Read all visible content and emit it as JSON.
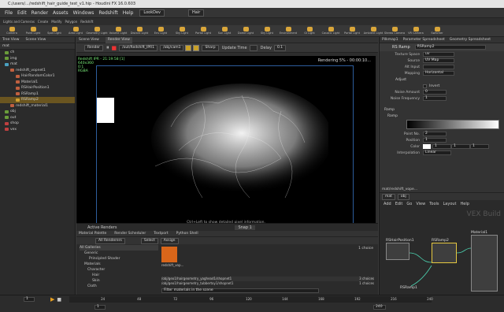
{
  "window": {
    "title": "C:/users/.../redshift_hair_guide_test_v1.hip - Houdini FX 16.0.603"
  },
  "menu": {
    "items": [
      "File",
      "Edit",
      "Render",
      "Assets",
      "Windows",
      "Redshift",
      "Help"
    ],
    "desktop": "LookDev",
    "scene": "Hair"
  },
  "shelf": {
    "tabs": [
      "Lights and Cameras",
      "Create",
      "Modify",
      "Polygon",
      "Redshift"
    ],
    "tools": [
      "Camera",
      "Point Light",
      "Spot Light",
      "Area Light",
      "Geometry Light",
      "Volume Light",
      "Distant Light",
      "Env Light",
      "Sky Light",
      "Portal Light",
      "Sun Light",
      "Dome Light",
      "Sky Light",
      "Environment",
      "GI Light",
      "Caustic Light",
      "Portal Light",
      "Ambient Light",
      "Stereo Camera",
      "VR Camera",
      "Switcher"
    ]
  },
  "tree": {
    "tabs": [
      "Tree View",
      "Scene View"
    ],
    "path": "mat",
    "items": [
      {
        "label": "ch",
        "level": 0,
        "color": "#6a9c3a"
      },
      {
        "label": "img",
        "level": 0,
        "color": "#6a9c3a"
      },
      {
        "label": "mat",
        "level": 0,
        "color": "#4aa0c0"
      },
      {
        "label": "redshift_vopnet1",
        "level": 1,
        "color": "#c06040"
      },
      {
        "label": "HairRandomColor1",
        "level": 2,
        "color": "#c06040"
      },
      {
        "label": "Material1",
        "level": 2,
        "color": "#c06040"
      },
      {
        "label": "RSHairPosition1",
        "level": 2,
        "color": "#c06040"
      },
      {
        "label": "RSRamp1",
        "level": 2,
        "color": "#c06040"
      },
      {
        "label": "RSRamp2",
        "level": 2,
        "color": "#d0a030",
        "selected": true
      },
      {
        "label": "redshift_material1",
        "level": 1,
        "color": "#c06040"
      },
      {
        "label": "obj",
        "level": 0,
        "color": "#6a9c3a"
      },
      {
        "label": "out",
        "level": 0,
        "color": "#6a9c3a"
      },
      {
        "label": "shop",
        "level": 0,
        "color": "#c04040"
      },
      {
        "label": "vex",
        "level": 0,
        "color": "#c04040"
      }
    ]
  },
  "center": {
    "tabs": [
      "Scene View",
      "Render View"
    ],
    "render_label": "Render",
    "rop": "/out/Redshift_IPR1",
    "camera": "/obj/cam1",
    "sharp": "Sharp",
    "update_time": "Update Time",
    "delay": "Delay",
    "delay_val": "0.1",
    "info": "Redshift IPR - 21:19:58 [1]",
    "info2": "640x360",
    "info3": "0:1",
    "info4": "RGBA",
    "progress": "Rendering 5% - 00:00:10...",
    "hint": "Ctrl+Left to show detailed pixel information.",
    "bottom_tabs": [
      "Active Renders",
      "Snap 1"
    ]
  },
  "matpal": {
    "tabs": [
      "Material Palette",
      "Render Scheduler",
      "Textport",
      "Python Shell"
    ],
    "renderers": "All Renderers",
    "select": "Select",
    "assign": "Assign",
    "galleries": [
      "All Galleries",
      "Generic",
      "Principled Shader",
      "Materials",
      "Character",
      "Hair",
      "Skin",
      "Cloth"
    ],
    "thumb_label": "redshift_vop...",
    "choice": "1 choice",
    "paths": [
      {
        "p": "/obj/geo1/hairgeometry_yaghead1/shopnet1",
        "n": "3 choices"
      },
      {
        "p": "/obj/geo1/hairgeometry_tubbertoy1/shopnet1",
        "n": "1 choices"
      }
    ],
    "filter": "Filter materials in the scene"
  },
  "params": {
    "tabs": [
      "Pilkmap1",
      "Parameter Spreadsheet",
      "Geometry Spreadsheet"
    ],
    "node_type": "RS Ramp",
    "node_name": "RSRamp2",
    "rows": [
      {
        "l": "Texture Space",
        "v": "uv"
      },
      {
        "l": "Source",
        "v": "UV Map"
      },
      {
        "l": "Alt Input",
        "v": ""
      },
      {
        "l": "Mapping",
        "v": "Horizontal"
      }
    ],
    "adjust": "Adjust",
    "invert": "Invert",
    "noise_amount": "Noise Amount",
    "noise_amount_v": "0",
    "noise_freq": "Noise Frequency",
    "noise_freq_v": "1",
    "ramp": "Ramp",
    "ramp_sub": "Ramp",
    "point_no": "Point No.",
    "point_no_v": "2",
    "position": "Position",
    "position_v": "1",
    "color": "Color",
    "color_r": "1",
    "color_g": "1",
    "color_b": "1",
    "interp": "Interpolation",
    "interp_v": "Linear"
  },
  "network": {
    "path": "mat/redshift_vope...",
    "tabs": [
      "mat",
      "obj"
    ],
    "menu": [
      "Add",
      "Edit",
      "Go",
      "View",
      "Tools",
      "Layout",
      "Help"
    ],
    "watermark": "VEX Build",
    "nodes": [
      {
        "label": "RSHairPosition1"
      },
      {
        "label": "RSRamp2"
      },
      {
        "label": "Material1"
      },
      {
        "label": "RSRamp1"
      }
    ]
  },
  "timeline": {
    "frame": "1",
    "start": "1",
    "end": "240",
    "ticks": [
      "24",
      "48",
      "72",
      "96",
      "120",
      "144",
      "168",
      "192",
      "216",
      "240"
    ]
  }
}
